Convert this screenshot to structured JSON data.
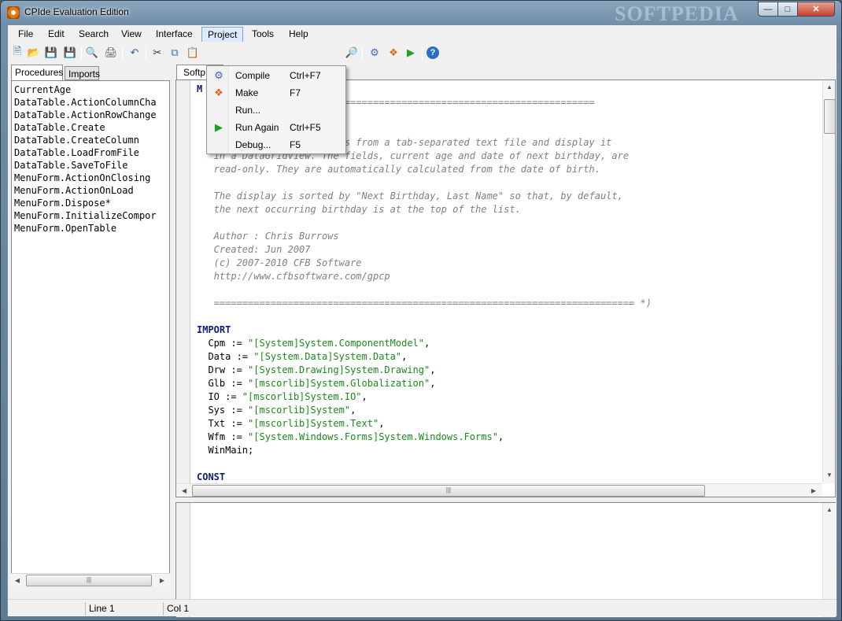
{
  "window": {
    "title": "CPIde Evaluation Edition",
    "watermark": "SOFTPEDIA"
  },
  "menubar": {
    "items": [
      "File",
      "Edit",
      "Search",
      "View",
      "Interface",
      "Project",
      "Tools",
      "Help"
    ]
  },
  "project_menu": {
    "items": [
      {
        "label": "Compile",
        "shortcut": "Ctrl+F7",
        "icon": "gear-icon"
      },
      {
        "label": "Make",
        "shortcut": "F7",
        "icon": "make-icon"
      },
      {
        "label": "Run...",
        "shortcut": "",
        "icon": ""
      },
      {
        "label": "Run Again",
        "shortcut": "Ctrl+F5",
        "icon": "play-icon"
      },
      {
        "label": "Debug...",
        "shortcut": "F5",
        "icon": ""
      }
    ]
  },
  "left_panel": {
    "tabs": [
      "Procedures",
      "Imports"
    ],
    "procedures": [
      "CurrentAge",
      "DataTable.ActionColumnCha",
      "DataTable.ActionRowChange",
      "DataTable.Create",
      "DataTable.CreateColumn",
      "DataTable.LoadFromFile",
      "DataTable.SaveToFile",
      "MenuForm.ActionOnClosing",
      "MenuForm.ActionOnLoad",
      "MenuForm.Dispose*",
      "MenuForm.InitializeCompor",
      "MenuForm.OpenTable"
    ]
  },
  "editor": {
    "tab": "Softp",
    "lines": [
      {
        "t": "M",
        "c": "kw"
      },
      {
        "t": "  ====================================================================",
        "c": "cmt"
      },
      {
        "t": "  inForms DataGrid Program",
        "c": "cmt"
      },
      {
        "t": "",
        "c": ""
      },
      {
        "t": "   Read a list of birthdays from a tab-separated text file and display it",
        "c": "cmt"
      },
      {
        "t": "   in a DataGridView. The fields, current age and date of next birthday, are",
        "c": "cmt"
      },
      {
        "t": "   read-only. They are automatically calculated from the date of birth.",
        "c": "cmt"
      },
      {
        "t": "",
        "c": ""
      },
      {
        "t": "   The display is sorted by \"Next Birthday, Last Name\" so that, by default,",
        "c": "cmt"
      },
      {
        "t": "   the next occurring birthday is at the top of the list.",
        "c": "cmt"
      },
      {
        "t": "",
        "c": ""
      },
      {
        "t": "   Author : Chris Burrows",
        "c": "cmt"
      },
      {
        "t": "   Created: Jun 2007",
        "c": "cmt"
      },
      {
        "t": "   (c) 2007-2010 CFB Software",
        "c": "cmt"
      },
      {
        "t": "   http://www.cfbsoftware.com/gpcp",
        "c": "cmt"
      },
      {
        "t": "",
        "c": ""
      },
      {
        "t": "   ========================================================================== *)",
        "c": "cmt"
      },
      {
        "t": "",
        "c": ""
      },
      {
        "t": "IMPORT",
        "c": "kw"
      },
      {
        "t": "  Cpm := ",
        "c": "",
        "s": "\"[System]System.ComponentModel\"",
        "e": ","
      },
      {
        "t": "  Data := ",
        "c": "",
        "s": "\"[System.Data]System.Data\"",
        "e": ","
      },
      {
        "t": "  Drw := ",
        "c": "",
        "s": "\"[System.Drawing]System.Drawing\"",
        "e": ","
      },
      {
        "t": "  Glb := ",
        "c": "",
        "s": "\"[mscorlib]System.Globalization\"",
        "e": ","
      },
      {
        "t": "  IO := ",
        "c": "",
        "s": "\"[mscorlib]System.IO\"",
        "e": ","
      },
      {
        "t": "  Sys := ",
        "c": "",
        "s": "\"[mscorlib]System\"",
        "e": ","
      },
      {
        "t": "  Txt := ",
        "c": "",
        "s": "\"[mscorlib]System.Text\"",
        "e": ","
      },
      {
        "t": "  Wfm := ",
        "c": "",
        "s": "\"[System.Windows.Forms]System.Windows.Forms\"",
        "e": ","
      },
      {
        "t": "  WinMain;",
        "c": ""
      },
      {
        "t": "",
        "c": ""
      },
      {
        "t": "CONST",
        "c": "kw"
      }
    ]
  },
  "statusbar": {
    "line": "Line 1",
    "col": "Col 1"
  }
}
